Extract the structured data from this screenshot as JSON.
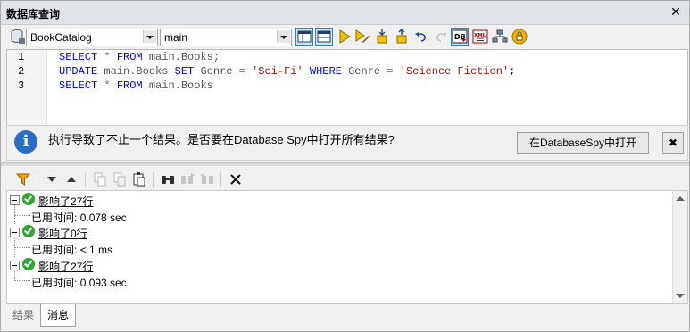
{
  "window": {
    "title": "数据库查询",
    "close_glyph": "✕"
  },
  "toolbar": {
    "datasource": "BookCatalog",
    "schema": "main",
    "icons": [
      "database-icon",
      "editor-layout-icon",
      "results-layout-icon",
      "execute-icon",
      "execute-for-edit-icon",
      "import-icon",
      "export-icon",
      "undo-icon",
      "redo-icon",
      "db-icon",
      "xml-icon",
      "connections-icon",
      "lock-icon"
    ]
  },
  "editor": {
    "line_numbers": [
      "1",
      "2",
      "3"
    ],
    "lines": [
      [
        {
          "t": "SELECT",
          "c": "kw"
        },
        {
          "t": " ",
          "c": "pn"
        },
        {
          "t": "*",
          "c": "op"
        },
        {
          "t": " ",
          "c": "pn"
        },
        {
          "t": "FROM",
          "c": "kw"
        },
        {
          "t": " ",
          "c": "pn"
        },
        {
          "t": "main.Books;",
          "c": "id"
        }
      ],
      [
        {
          "t": "UPDATE",
          "c": "kw"
        },
        {
          "t": " ",
          "c": "pn"
        },
        {
          "t": "main.Books",
          "c": "id"
        },
        {
          "t": " ",
          "c": "pn"
        },
        {
          "t": "SET",
          "c": "kw"
        },
        {
          "t": " Genre ",
          "c": "id"
        },
        {
          "t": "=",
          "c": "op"
        },
        {
          "t": " ",
          "c": "pn"
        },
        {
          "t": "'Sci-Fi'",
          "c": "str"
        },
        {
          "t": " ",
          "c": "pn"
        },
        {
          "t": "WHERE",
          "c": "kw"
        },
        {
          "t": " Genre ",
          "c": "id"
        },
        {
          "t": "=",
          "c": "op"
        },
        {
          "t": " ",
          "c": "pn"
        },
        {
          "t": "'Science Fiction'",
          "c": "str"
        },
        {
          "t": ";",
          "c": "pn"
        }
      ],
      [
        {
          "t": "SELECT",
          "c": "kw"
        },
        {
          "t": " ",
          "c": "pn"
        },
        {
          "t": "*",
          "c": "op"
        },
        {
          "t": " ",
          "c": "pn"
        },
        {
          "t": "FROM",
          "c": "kw"
        },
        {
          "t": " ",
          "c": "pn"
        },
        {
          "t": "main.Books",
          "c": "id"
        }
      ]
    ]
  },
  "infobar": {
    "icon_glyph": "i",
    "message": "执行导致了不止一个结果。是否要在Database Spy中打开所有结果?",
    "open_button": "在DatabaseSpy中打开",
    "close_glyph": "✖"
  },
  "results_toolbar": {
    "icons": [
      "filter-icon",
      "next-icon",
      "previous-icon",
      "copy-icon",
      "copy-all-icon",
      "paste-icon",
      "find-icon",
      "find-next-icon",
      "find-previous-icon",
      "clear-icon"
    ]
  },
  "messages": [
    {
      "summary": "影响了27行",
      "elapsed_label": "已用时间:",
      "elapsed_value": "0.078 sec"
    },
    {
      "summary": "影响了0行",
      "elapsed_label": "已用时间:",
      "elapsed_value": "< 1 ms"
    },
    {
      "summary": "影响了27行",
      "elapsed_label": "已用时间:",
      "elapsed_value": "0.093 sec"
    }
  ],
  "tabs": [
    {
      "label": "结果",
      "active": false
    },
    {
      "label": "消息",
      "active": true
    }
  ],
  "colors": {
    "keyword": "#0000ff",
    "string": "#a31515",
    "info": "#2b6cc4",
    "success": "#2fa62f"
  }
}
